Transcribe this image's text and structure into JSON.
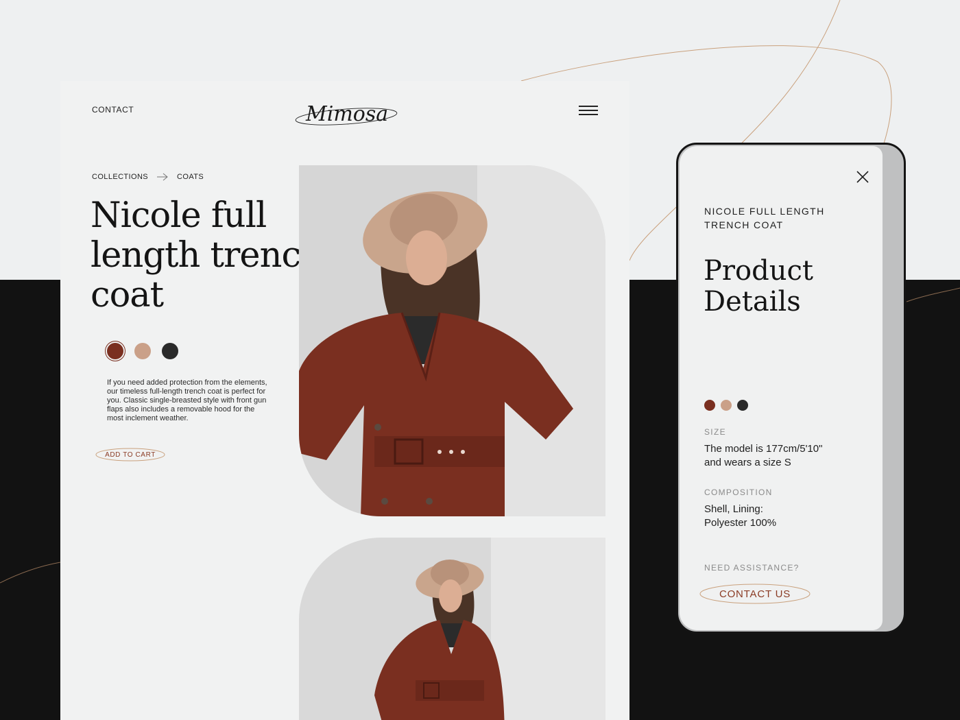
{
  "desktop": {
    "nav_contact": "CONTACT",
    "logo_text": "Mimosa",
    "breadcrumb": [
      "COLLECTIONS",
      "COATS"
    ],
    "title": "Nicole full length trench coat",
    "swatches": [
      "#7a2f20",
      "#caa088",
      "#2a2a2a"
    ],
    "description": "If you need added protection from the elements, our timeless full-length trench coat is perfect for you. Classic single-breasted style with front gun flaps also includes a removable hood for the most inclement weather.",
    "add_to_cart": "ADD TO CART"
  },
  "mobile": {
    "subtitle_line1": "NICOLE FULL LENGTH",
    "subtitle_line2": "TRENCH COAT",
    "title_line1": "Product",
    "title_line2": "Details",
    "swatches": [
      "#7a2f20",
      "#caa088",
      "#2a2a2a"
    ],
    "size_label": "SIZE",
    "size_line1": "The model is 177cm/5'10\"",
    "size_line2": "and wears a size S",
    "composition_label": "COMPOSITION",
    "composition_line1": "Shell, Lining:",
    "composition_line2": "Polyester 100%",
    "assistance_label": "NEED ASSISTANCE?",
    "contact_us": "CONTACT US"
  },
  "colors": {
    "accent": "#8a3b24",
    "coat": "#7a2f20",
    "hat": "#c9a58c",
    "dark_bg": "#121212"
  }
}
